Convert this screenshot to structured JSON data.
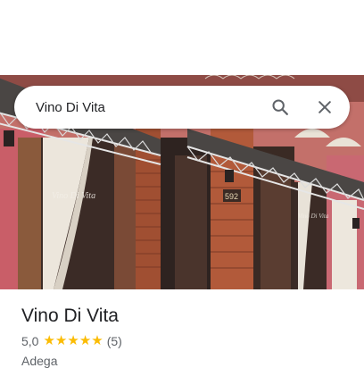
{
  "search": {
    "query": "Vino Di Vita"
  },
  "place": {
    "name": "Vino Di Vita",
    "rating": "5,0",
    "rating_value": 5,
    "review_count": "(5)",
    "category": "Adega",
    "photo_sign": "Vino Di Vita",
    "house_number": "592"
  },
  "icons": {
    "search": "search-icon",
    "clear": "close-icon",
    "star": "star-icon"
  },
  "colors": {
    "star": "#fbbc04",
    "title": "#202124",
    "secondary": "#5f6368",
    "facade": "#c3706a",
    "brick": "#a04f32"
  }
}
